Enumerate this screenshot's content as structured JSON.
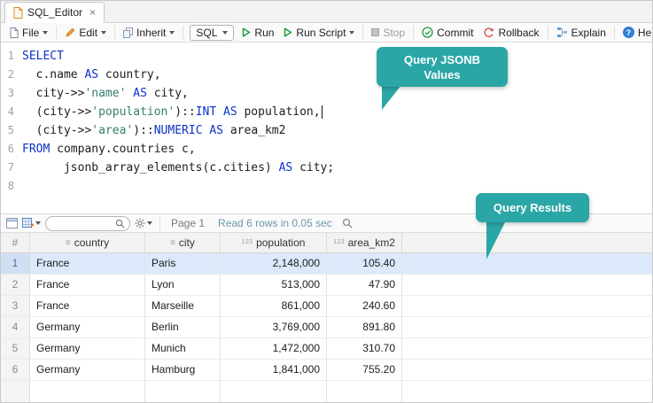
{
  "window": {
    "tab_title": "SQL_Editor",
    "tab_close": "×"
  },
  "toolbar": {
    "file_label": "File",
    "edit_label": "Edit",
    "inherit_label": "Inherit",
    "sql_label": "SQL",
    "run_label": "Run",
    "run_script_label": "Run Script",
    "stop_label": "Stop",
    "commit_label": "Commit",
    "rollback_label": "Rollback",
    "explain_label": "Explain",
    "help_label": "Help",
    "help_glyph": "?"
  },
  "editor": {
    "lines": [
      {
        "num": "1",
        "tokens": [
          [
            "k",
            "SELECT"
          ]
        ]
      },
      {
        "num": "2",
        "tokens": [
          [
            "p",
            "  c.name "
          ],
          [
            "k",
            "AS"
          ],
          [
            "p",
            " country,"
          ]
        ]
      },
      {
        "num": "3",
        "tokens": [
          [
            "p",
            "  city->>"
          ],
          [
            "s",
            "'name'"
          ],
          [
            "p",
            " "
          ],
          [
            "k",
            "AS"
          ],
          [
            "p",
            " city,"
          ]
        ]
      },
      {
        "num": "4",
        "tokens": [
          [
            "p",
            "  (city->>"
          ],
          [
            "s",
            "'population'"
          ],
          [
            "p",
            ")::"
          ],
          [
            "k",
            "INT"
          ],
          [
            "p",
            " "
          ],
          [
            "k",
            "AS"
          ],
          [
            "p",
            " population,"
          ]
        ],
        "caret": true
      },
      {
        "num": "5",
        "tokens": [
          [
            "p",
            "  (city->>"
          ],
          [
            "s",
            "'area'"
          ],
          [
            "p",
            ")::"
          ],
          [
            "k",
            "NUMERIC"
          ],
          [
            "p",
            " "
          ],
          [
            "k",
            "AS"
          ],
          [
            "p",
            " area_km2"
          ]
        ]
      },
      {
        "num": "6",
        "tokens": [
          [
            "k",
            "FROM"
          ],
          [
            "p",
            " company.countries c,"
          ]
        ]
      },
      {
        "num": "7",
        "tokens": [
          [
            "p",
            "      jsonb_array_elements(c.cities) "
          ],
          [
            "k",
            "AS"
          ],
          [
            "p",
            " city;"
          ]
        ]
      },
      {
        "num": "8",
        "tokens": []
      }
    ]
  },
  "callouts": {
    "editor": "Query JSONB Values",
    "results": "Query Results"
  },
  "results_toolbar": {
    "page": "Page 1",
    "status": "Read 6 rows in 0.05 sec"
  },
  "grid": {
    "corner_label": "#",
    "columns": [
      {
        "name": "country",
        "type": "text"
      },
      {
        "name": "city",
        "type": "text"
      },
      {
        "name": "population",
        "type": "num"
      },
      {
        "name": "area_km2",
        "type": "num"
      }
    ],
    "rows": [
      {
        "n": "1",
        "cells": [
          "France",
          "Paris",
          "2,148,000",
          "105.40"
        ],
        "selected": true
      },
      {
        "n": "2",
        "cells": [
          "France",
          "Lyon",
          "513,000",
          "47.90"
        ],
        "selected": false
      },
      {
        "n": "3",
        "cells": [
          "France",
          "Marseille",
          "861,000",
          "240.60"
        ],
        "selected": false
      },
      {
        "n": "4",
        "cells": [
          "Germany",
          "Berlin",
          "3,769,000",
          "891.80"
        ],
        "selected": false
      },
      {
        "n": "5",
        "cells": [
          "Germany",
          "Munich",
          "1,472,000",
          "310.70"
        ],
        "selected": false
      },
      {
        "n": "6",
        "cells": [
          "Germany",
          "Hamburg",
          "1,841,000",
          "755.20"
        ],
        "selected": false
      }
    ]
  },
  "colors": {
    "callout_teal": "#2ba6a6",
    "keyword_blue": "#0c31c8",
    "string_green": "#357d6e",
    "selected_row": "#dbe9fa"
  }
}
